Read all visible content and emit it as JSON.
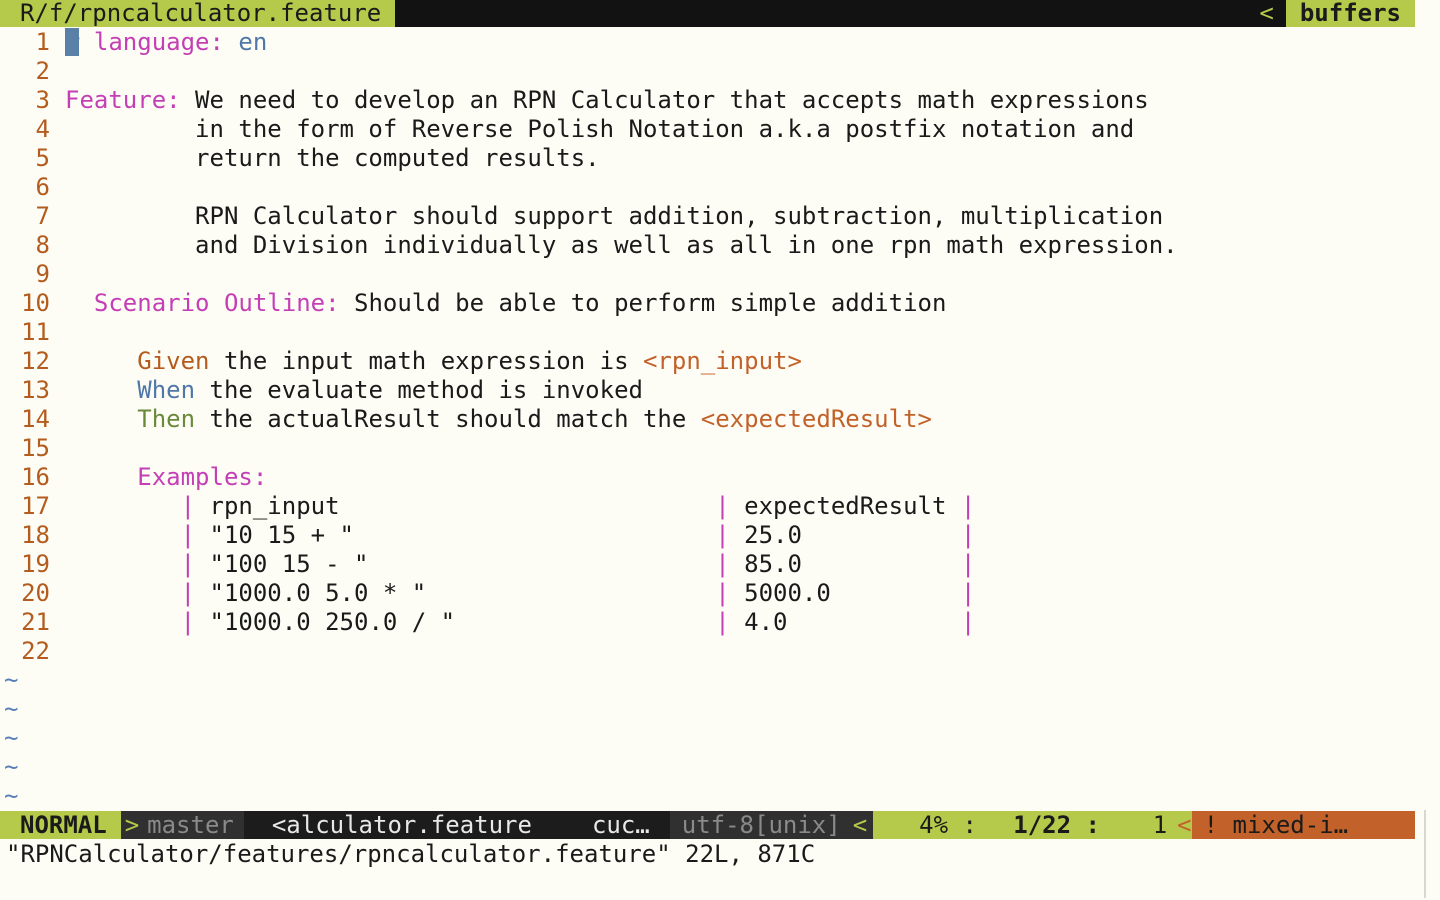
{
  "tabline": {
    "active_tab": "R/f/rpncalculator.feature",
    "sep": "<",
    "buffers_label": "buffers"
  },
  "editor": {
    "lines": [
      {
        "num": "1"
      },
      {
        "num": "2"
      },
      {
        "num": "3"
      },
      {
        "num": "4"
      },
      {
        "num": "5"
      },
      {
        "num": "6"
      },
      {
        "num": "7"
      },
      {
        "num": "8"
      },
      {
        "num": "9"
      },
      {
        "num": "10"
      },
      {
        "num": "11"
      },
      {
        "num": "12"
      },
      {
        "num": "13"
      },
      {
        "num": "14"
      },
      {
        "num": "15"
      },
      {
        "num": "16"
      },
      {
        "num": "17"
      },
      {
        "num": "18"
      },
      {
        "num": "19"
      },
      {
        "num": "20"
      },
      {
        "num": "21"
      },
      {
        "num": "22"
      }
    ],
    "text": {
      "l1_kw": "language:",
      "l1_val": "en",
      "l3_kw": "Feature:",
      "l3_text": " We need to develop an RPN Calculator that accepts math expressions",
      "l4_text": "         in the form of Reverse Polish Notation a.k.a postfix notation and",
      "l5_text": "         return the computed results.",
      "l7_text": "         RPN Calculator should support addition, subtraction, multiplication",
      "l8_text": "         and Division individually as well as all in one rpn math expression.",
      "l10_kw": "Scenario Outline:",
      "l10_text": " Should be able to perform simple addition",
      "l12_kw": "Given",
      "l12_text": " the input math expression is ",
      "l12_param": "<rpn_input>",
      "l13_kw": "When",
      "l13_text": " the evaluate method is invoked",
      "l14_kw": "Then",
      "l14_text": " the actualResult should match the ",
      "l14_param": "<expectedResult>",
      "l16_kw": "Examples:",
      "pipe": "|",
      "table": {
        "header": [
          " rpn_input                          ",
          " expectedResult "
        ],
        "rows": [
          [
            " \"10 15 + \"                         ",
            " 25.0           "
          ],
          [
            " \"100 15 - \"                        ",
            " 85.0           "
          ],
          [
            " \"1000.0 5.0 * \"                    ",
            " 5000.0         "
          ],
          [
            " \"1000.0 250.0 / \"                  ",
            " 4.0            "
          ]
        ]
      }
    },
    "tilde": "~"
  },
  "statusline": {
    "mode": "NORMAL",
    "arrow": ">",
    "branch": "master",
    "file": "<alculator.feature",
    "filetype": "cuc…",
    "encoding": "utf-8[unix]",
    "arrow_left": "<",
    "percent": "4% :",
    "lines": "1/22 :",
    "col": "1",
    "warn_arrow": "<",
    "warning": "! mixed-i…"
  },
  "cmdline": {
    "message": "\"RPNCalculator/features/rpncalculator.feature\" 22L, 871C"
  },
  "colors": {
    "accent": "#b5c94a",
    "line_number": "#b35c1e",
    "keyword": "#c43fb5",
    "warning": "#c2622a",
    "background": "#fdfdf6"
  }
}
